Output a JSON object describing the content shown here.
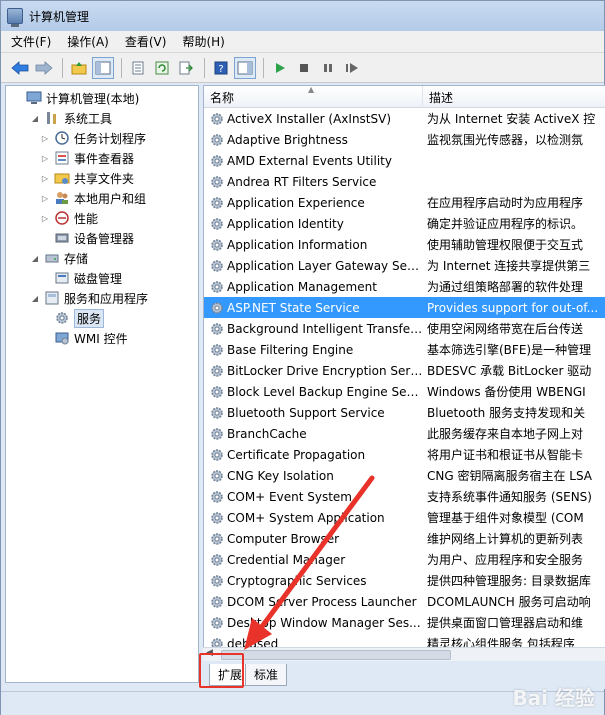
{
  "window": {
    "title": "计算机管理"
  },
  "menubar": [
    {
      "label": "文件(F)"
    },
    {
      "label": "操作(A)"
    },
    {
      "label": "查看(V)"
    },
    {
      "label": "帮助(H)"
    }
  ],
  "tree": {
    "items": [
      {
        "label": "计算机管理(本地)",
        "level": 0,
        "expander": "",
        "icon": "computer-icon"
      },
      {
        "label": "系统工具",
        "level": 1,
        "expander": "◢",
        "icon": "tools-icon"
      },
      {
        "label": "任务计划程序",
        "level": 2,
        "expander": "▷",
        "icon": "clock-icon"
      },
      {
        "label": "事件查看器",
        "level": 2,
        "expander": "▷",
        "icon": "event-viewer-icon"
      },
      {
        "label": "共享文件夹",
        "level": 2,
        "expander": "▷",
        "icon": "shared-folder-icon"
      },
      {
        "label": "本地用户和组",
        "level": 2,
        "expander": "▷",
        "icon": "users-icon"
      },
      {
        "label": "性能",
        "level": 2,
        "expander": "▷",
        "icon": "performance-icon"
      },
      {
        "label": "设备管理器",
        "level": 2,
        "expander": "",
        "icon": "device-manager-icon"
      },
      {
        "label": "存储",
        "level": 1,
        "expander": "◢",
        "icon": "storage-icon"
      },
      {
        "label": "磁盘管理",
        "level": 2,
        "expander": "",
        "icon": "disk-icon"
      },
      {
        "label": "服务和应用程序",
        "level": 1,
        "expander": "◢",
        "icon": "services-apps-icon"
      },
      {
        "label": "服务",
        "level": 2,
        "expander": "",
        "icon": "gear-icon",
        "selected": true
      },
      {
        "label": "WMI 控件",
        "level": 2,
        "expander": "",
        "icon": "wmi-icon"
      }
    ]
  },
  "list": {
    "columns": {
      "name": "名称",
      "desc": "描述"
    },
    "rows": [
      {
        "name": "ActiveX Installer (AxInstSV)",
        "desc": "为从 Internet 安装 ActiveX 控"
      },
      {
        "name": "Adaptive Brightness",
        "desc": "监视氛围光传感器，以检测氛"
      },
      {
        "name": "AMD External Events Utility",
        "desc": ""
      },
      {
        "name": "Andrea RT Filters Service",
        "desc": ""
      },
      {
        "name": "Application Experience",
        "desc": "在应用程序启动时为应用程序"
      },
      {
        "name": "Application Identity",
        "desc": "确定并验证应用程序的标识。"
      },
      {
        "name": "Application Information",
        "desc": "使用辅助管理权限便于交互式"
      },
      {
        "name": "Application Layer Gateway Servi...",
        "desc": "为 Internet 连接共享提供第三"
      },
      {
        "name": "Application Management",
        "desc": "为通过组策略部署的软件处理"
      },
      {
        "name": "ASP.NET State Service",
        "desc": "Provides support for out-of...",
        "selected": true
      },
      {
        "name": "Background Intelligent Transfer...",
        "desc": "使用空闲网络带宽在后台传送"
      },
      {
        "name": "Base Filtering Engine",
        "desc": "基本筛选引擎(BFE)是一种管理"
      },
      {
        "name": "BitLocker Drive Encryption Servi...",
        "desc": "BDESVC 承载 BitLocker 驱动"
      },
      {
        "name": "Block Level Backup Engine Serv...",
        "desc": "Windows 备份使用 WBENGI"
      },
      {
        "name": "Bluetooth Support Service",
        "desc": "Bluetooth 服务支持发现和关"
      },
      {
        "name": "BranchCache",
        "desc": "此服务缓存来自本地子网上对"
      },
      {
        "name": "Certificate Propagation",
        "desc": "将用户证书和根证书从智能卡"
      },
      {
        "name": "CNG Key Isolation",
        "desc": "CNG 密钥隔离服务宿主在 LSA"
      },
      {
        "name": "COM+ Event System",
        "desc": "支持系统事件通知服务 (SENS)"
      },
      {
        "name": "COM+ System Application",
        "desc": "管理基于组件对象模型 (COM"
      },
      {
        "name": "Computer Browser",
        "desc": "维护网络上计算机的更新列表"
      },
      {
        "name": "Credential Manager",
        "desc": "为用户、应用程序和安全服务"
      },
      {
        "name": "Cryptographic Services",
        "desc": "提供四种管理服务: 目录数据库"
      },
      {
        "name": "DCOM Server Process Launcher",
        "desc": "DCOMLAUNCH 服务可启动响"
      },
      {
        "name": "Desktop Window Manager Ses...",
        "desc": "提供桌面窗口管理器启动和维"
      },
      {
        "name": "debased",
        "desc": "精灵核心组件服务 包括程序"
      }
    ]
  },
  "tabs": [
    {
      "label": "扩展",
      "active": true
    },
    {
      "label": "标准",
      "active": false
    }
  ],
  "watermark": "Bai 经验"
}
